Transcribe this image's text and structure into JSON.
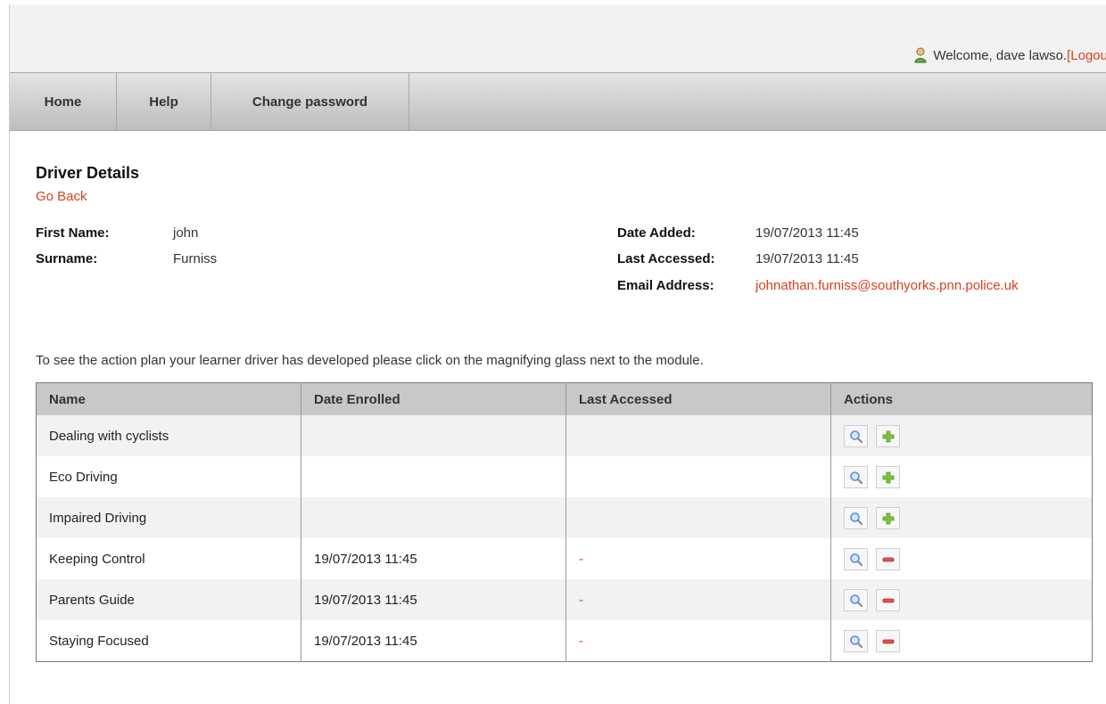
{
  "header": {
    "welcome_text": "Welcome, dave lawso. ",
    "logout_label": "[Logou"
  },
  "nav": {
    "items": [
      {
        "label": "Home"
      },
      {
        "label": "Help"
      },
      {
        "label": "Change password"
      }
    ]
  },
  "page": {
    "title": "Driver Details",
    "go_back": "Go Back",
    "details": {
      "first_name_label": "First Name:",
      "first_name": "john",
      "surname_label": "Surname:",
      "surname": "Furniss",
      "date_added_label": "Date Added:",
      "date_added": "19/07/2013 11:45",
      "last_accessed_label": "Last Accessed:",
      "last_accessed": "19/07/2013 11:45",
      "email_label": "Email Address:",
      "email": "johnathan.furniss@southyorks.pnn.police.uk"
    },
    "info_text": "To see the action plan your learner driver has developed please click on the magnifying glass next to the module."
  },
  "table": {
    "headers": [
      "Name",
      "Date Enrolled",
      "Last Accessed",
      "Actions"
    ],
    "rows": [
      {
        "name": "Dealing with cyclists",
        "enrolled": "",
        "accessed": "",
        "action": "add"
      },
      {
        "name": "Eco Driving",
        "enrolled": "",
        "accessed": "",
        "action": "add"
      },
      {
        "name": "Impaired Driving",
        "enrolled": "",
        "accessed": "",
        "action": "add"
      },
      {
        "name": "Keeping Control",
        "enrolled": "19/07/2013 11:45",
        "accessed": "-",
        "action": "remove"
      },
      {
        "name": "Parents Guide",
        "enrolled": "19/07/2013 11:45",
        "accessed": "-",
        "action": "remove"
      },
      {
        "name": "Staying Focused",
        "enrolled": "19/07/2013 11:45",
        "accessed": "-",
        "action": "remove"
      }
    ]
  },
  "colors": {
    "accent_link": "#d9411e",
    "add_icon": "#7ec13a",
    "remove_icon": "#e05050",
    "magnify_icon": "#5b8fd6"
  },
  "icons": {
    "view": "magnifying-glass-icon",
    "add": "plus-icon",
    "remove": "minus-icon",
    "user": "user-icon"
  }
}
